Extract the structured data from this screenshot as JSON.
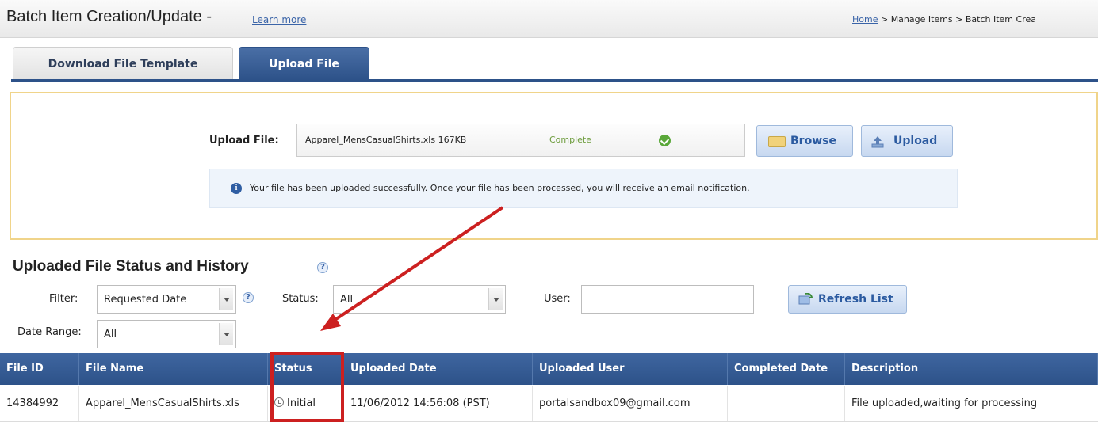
{
  "header": {
    "title": "Batch Item Creation/Update -",
    "learn_more": "Learn more",
    "breadcrumb_home": "Home",
    "breadcrumb_rest": " > Manage Items > Batch Item Crea"
  },
  "tabs": [
    {
      "label": "Download File Template",
      "active": false
    },
    {
      "label": "Upload File",
      "active": true
    }
  ],
  "upload": {
    "label": "Upload File:",
    "file_name": "Apparel_MensCasualShirts.xls  167KB",
    "status": "Complete",
    "status_icon": "check-circle-icon",
    "browse_label": "Browse",
    "upload_label": "Upload",
    "info_message": "Your file has been uploaded successfully. Once your file has been processed, you will receive an email notification."
  },
  "history": {
    "title": "Uploaded File Status and History",
    "filter_label": "Filter:",
    "filter_value": "Requested Date",
    "status_label": "Status:",
    "status_value": "All",
    "user_label": "User:",
    "user_value": "",
    "refresh_label": "Refresh List",
    "date_range_label": "Date Range:",
    "date_range_value": "All"
  },
  "table": {
    "columns": [
      "File ID",
      "File Name",
      "Status",
      "Uploaded Date",
      "Uploaded User",
      "Completed Date",
      "Description"
    ],
    "rows": [
      [
        "14384992",
        "Apparel_MensCasualShirts.xls",
        "Initial",
        "11/06/2012 14:56:08 (PST)",
        "portalsandbox09@gmail.com",
        "",
        "File uploaded,waiting for processing"
      ]
    ]
  },
  "colors": {
    "accent_blue": "#2d5289",
    "highlight_red": "#cc2020",
    "panel_border": "#f0d48a",
    "complete_green": "#6b9b3a"
  }
}
